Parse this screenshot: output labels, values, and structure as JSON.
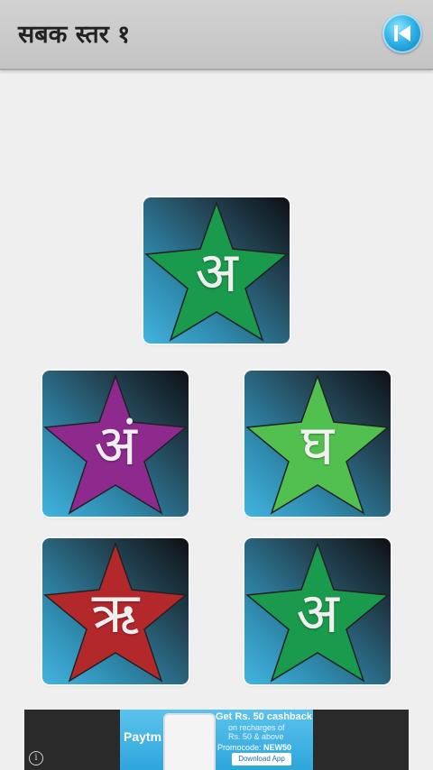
{
  "header": {
    "title": "सबक स्तर १",
    "back_icon": "skip-back-icon"
  },
  "tiles": [
    {
      "letter": "अ",
      "star_color": "#1a9a4c"
    },
    {
      "letter": "अं",
      "star_color": "#8e2a8e"
    },
    {
      "letter": "घ",
      "star_color": "#52c04f"
    },
    {
      "letter": "ऋ",
      "star_color": "#b3282b"
    },
    {
      "letter": "अ",
      "star_color": "#1a9a4c"
    }
  ],
  "ad": {
    "brand": "Paytm",
    "headline": "Get Rs. 50 cashback",
    "line1": "on recharges of",
    "line2": "Rs. 50 & above",
    "promo_label": "Promocode:",
    "promo_code": "NEW50",
    "cta": "Download App",
    "info_icon": "info-icon"
  }
}
